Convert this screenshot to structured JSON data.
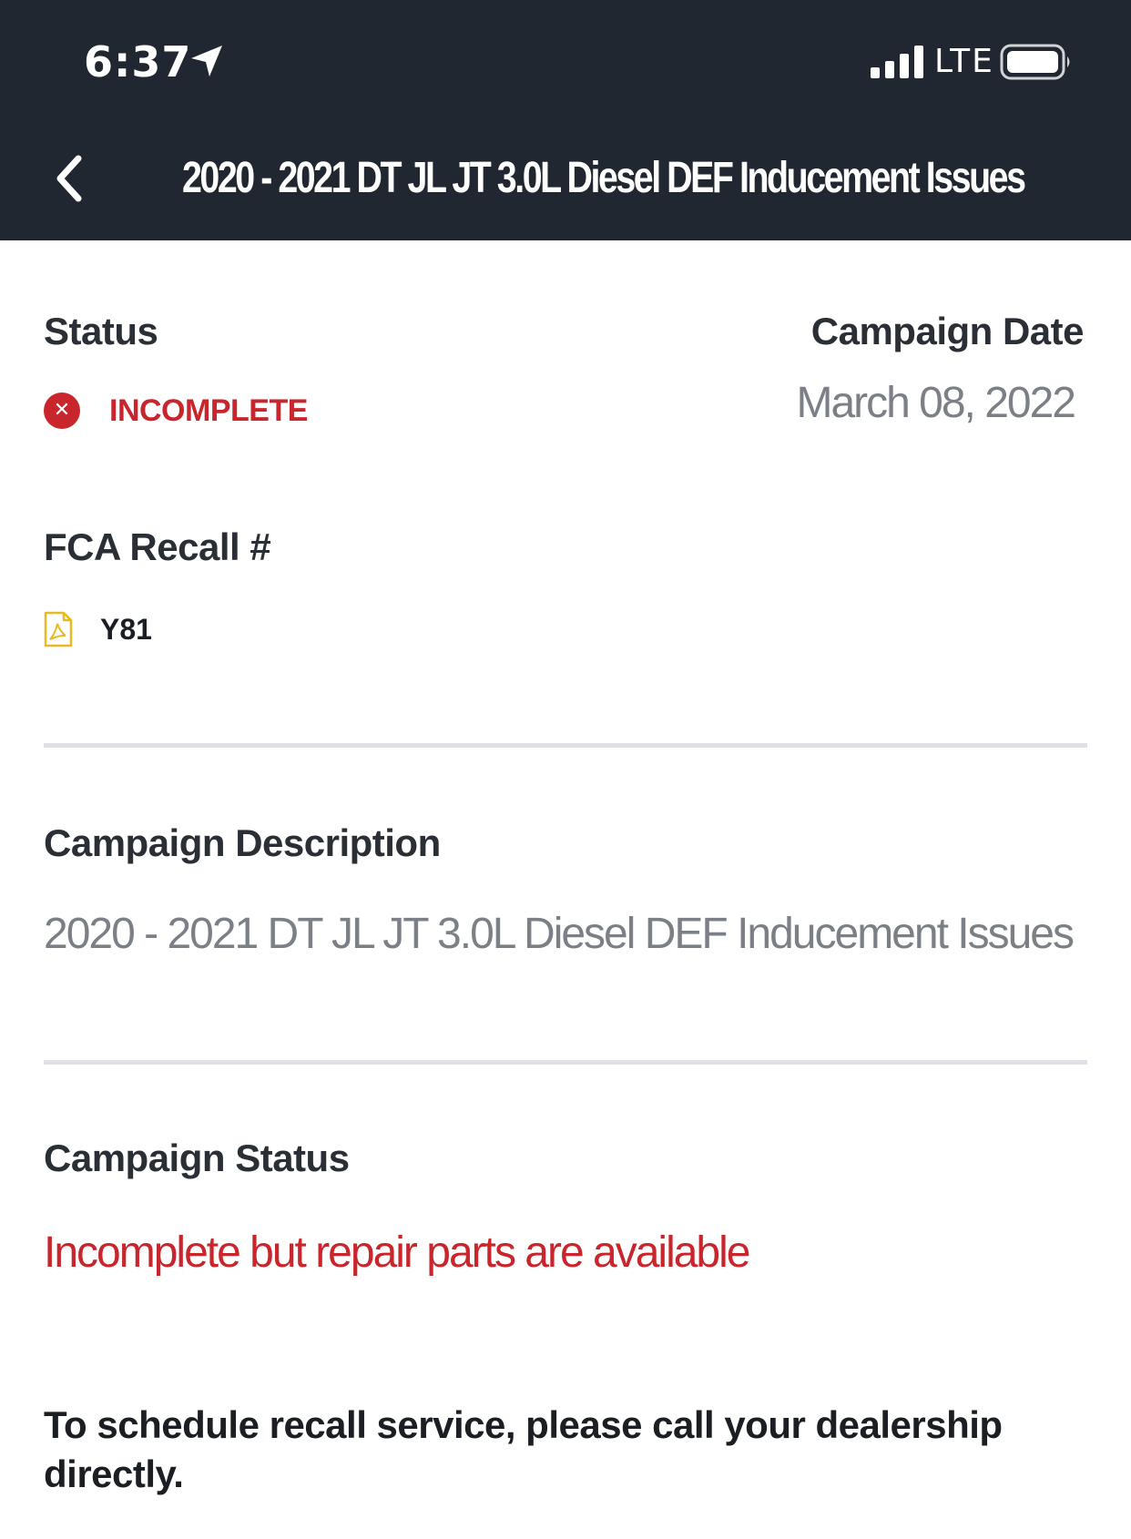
{
  "status_bar": {
    "time": "6:37",
    "network": "LTE",
    "icons": [
      "location-arrow-icon",
      "cellular-signal-icon",
      "battery-icon"
    ]
  },
  "nav": {
    "title": "2020 - 2021 DT JL JT 3.0L Diesel DEF Inducement Issues",
    "back_icon": "chevron-left-icon"
  },
  "details": {
    "status_label": "Status",
    "status_value": "INCOMPLETE",
    "status_icon": "x-circle-icon",
    "campaign_date_label": "Campaign Date",
    "campaign_date_value": "March 08, 2022",
    "recall_label": "FCA Recall #",
    "recall_value": "Y81",
    "recall_icon": "pdf-file-icon",
    "description_label": "Campaign Description",
    "description_value": "2020 - 2021 DT JL JT 3.0L Diesel DEF Inducement Issues",
    "campaign_status_label": "Campaign Status",
    "campaign_status_value": "Incomplete but repair parts are available",
    "schedule_note": "To schedule recall service, please call your dealership directly."
  },
  "colors": {
    "header_bg": "#212731",
    "accent_red": "#c8262c",
    "muted_text": "#7b7f86",
    "pdf_icon": "#e8b923",
    "divider": "#dfe1e6"
  }
}
